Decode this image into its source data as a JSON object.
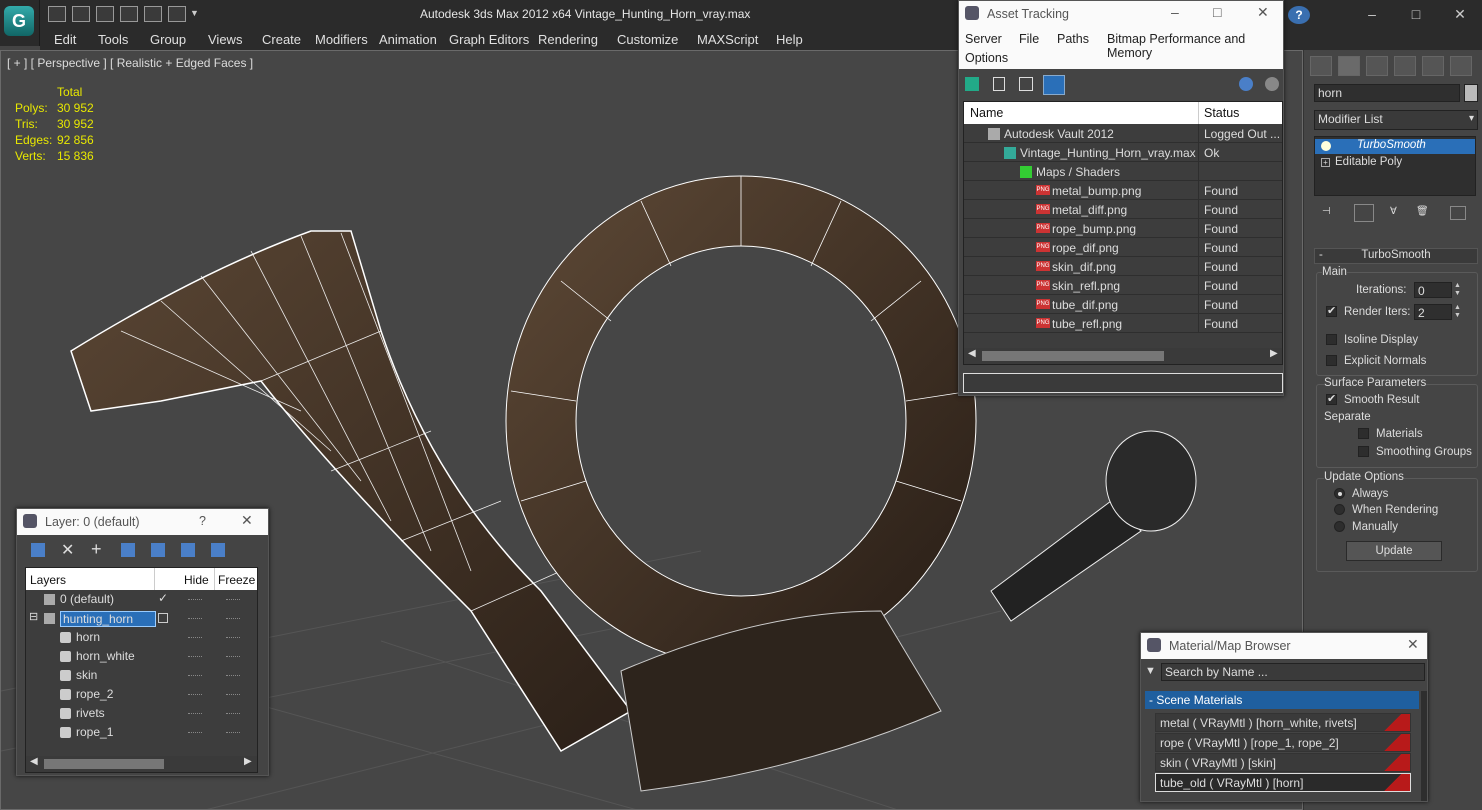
{
  "window": {
    "title": "Autodesk 3ds Max  2012 x64      Vintage_Hunting_Horn_vray.max",
    "minimize": "–",
    "maximize": "□",
    "close": "✕"
  },
  "help_icon": "?",
  "menu": [
    "Edit",
    "Tools",
    "Group",
    "Views",
    "Create",
    "Modifiers",
    "Animation",
    "Graph Editors",
    "Rendering",
    "Customize",
    "MAXScript",
    "Help"
  ],
  "viewport": {
    "label": "[ + ] [ Perspective ] [ Realistic + Edged Faces ]",
    "stats_header": "Total",
    "stats": [
      {
        "k": "Polys:",
        "v": "30 952"
      },
      {
        "k": "Tris:",
        "v": "30 952"
      },
      {
        "k": "Edges:",
        "v": "92 856"
      },
      {
        "k": "Verts:",
        "v": "15 836"
      }
    ]
  },
  "asset_tracking": {
    "title": "Asset Tracking",
    "menu": [
      "Server",
      "File",
      "Paths",
      "Bitmap Performance and Memory",
      "Options"
    ],
    "col_name": "Name",
    "col_status": "Status",
    "rows": [
      {
        "name": "Autodesk Vault 2012",
        "status": "Logged Out ..."
      },
      {
        "name": "Vintage_Hunting_Horn_vray.max",
        "status": "Ok"
      },
      {
        "name": "Maps / Shaders",
        "status": ""
      },
      {
        "name": "metal_bump.png",
        "status": "Found"
      },
      {
        "name": "metal_diff.png",
        "status": "Found"
      },
      {
        "name": "rope_bump.png",
        "status": "Found"
      },
      {
        "name": "rope_dif.png",
        "status": "Found"
      },
      {
        "name": "skin_dif.png",
        "status": "Found"
      },
      {
        "name": "skin_refl.png",
        "status": "Found"
      },
      {
        "name": "tube_dif.png",
        "status": "Found"
      },
      {
        "name": "tube_refl.png",
        "status": "Found"
      }
    ],
    "png_badge": "PNG"
  },
  "layers": {
    "title": "Layer: 0 (default)",
    "help": "?",
    "col_layers": "Layers",
    "col_hide": "Hide",
    "col_freeze": "Freeze",
    "rows": [
      "0 (default)",
      "hunting_horn",
      "horn",
      "horn_white",
      "skin",
      "rope_2",
      "rivets",
      "rope_1"
    ]
  },
  "command_panel": {
    "object_name": "horn",
    "modifier_list": "Modifier List",
    "stack": [
      "TurboSmooth",
      "Editable Poly"
    ],
    "rollout_title": "TurboSmooth",
    "main": "Main",
    "iterations_label": "Iterations:",
    "iterations": "0",
    "render_iters_label": "Render Iters:",
    "render_iters": "2",
    "isoline": "Isoline Display",
    "explicit": "Explicit Normals",
    "surface": "Surface Parameters",
    "smooth_result": "Smooth Result",
    "separate": "Separate",
    "materials": "Materials",
    "smoothing_groups": "Smoothing Groups",
    "update_options": "Update Options",
    "always": "Always",
    "when_rendering": "When Rendering",
    "manually": "Manually",
    "update_btn": "Update"
  },
  "material_browser": {
    "title": "Material/Map Browser",
    "search_placeholder": "Search by Name ...",
    "group": "- Scene Materials",
    "items": [
      "metal  ( VRayMtl )  [horn_white, rivets]",
      "rope  ( VRayMtl )  [rope_1, rope_2]",
      "skin  ( VRayMtl )  [skin]",
      "tube_old  ( VRayMtl )  [horn]"
    ]
  },
  "colors": {
    "accent": "#1f5f9f",
    "selection": "#2a6fb8",
    "material_swatch": "#b81a1a"
  }
}
